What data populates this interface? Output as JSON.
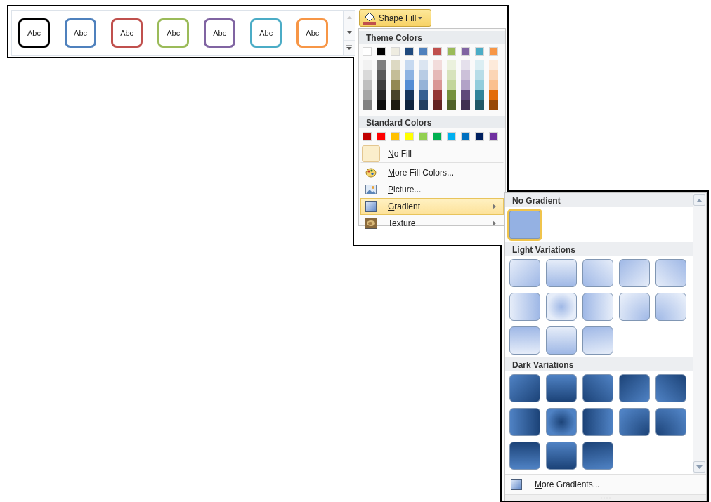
{
  "style_gallery": {
    "styles": [
      {
        "label": "Abc",
        "color": "#000000"
      },
      {
        "label": "Abc",
        "color": "#4f81bd"
      },
      {
        "label": "Abc",
        "color": "#c0504d"
      },
      {
        "label": "Abc",
        "color": "#9bbb59"
      },
      {
        "label": "Abc",
        "color": "#8064a2"
      },
      {
        "label": "Abc",
        "color": "#4bacc6"
      },
      {
        "label": "Abc",
        "color": "#f79646"
      }
    ]
  },
  "shape_fill_button": {
    "label": "Shape Fill"
  },
  "fill_menu": {
    "theme_header": "Theme Colors",
    "theme_colors": [
      {
        "color": "#ffffff",
        "shades": [
          {
            "color": "#f2f2f2"
          },
          {
            "color": "#d9d9d9"
          },
          {
            "color": "#bfbfbf"
          },
          {
            "color": "#a6a6a6"
          },
          {
            "color": "#808080"
          }
        ]
      },
      {
        "color": "#000000",
        "shades": [
          {
            "color": "#7f7f7f"
          },
          {
            "color": "#595959"
          },
          {
            "color": "#3f3f3f"
          },
          {
            "color": "#262626"
          },
          {
            "color": "#0d0d0d"
          }
        ]
      },
      {
        "color": "#eeece1",
        "shades": [
          {
            "color": "#ddd9c3"
          },
          {
            "color": "#c4bd97"
          },
          {
            "color": "#938953"
          },
          {
            "color": "#494429"
          },
          {
            "color": "#1d1b10"
          }
        ]
      },
      {
        "color": "#1f497d",
        "shades": [
          {
            "color": "#c6d9f0"
          },
          {
            "color": "#8db3e2"
          },
          {
            "color": "#548dd4"
          },
          {
            "color": "#17365d"
          },
          {
            "color": "#0f243e"
          }
        ]
      },
      {
        "color": "#4f81bd",
        "shades": [
          {
            "color": "#dbe5f1"
          },
          {
            "color": "#b8cce4"
          },
          {
            "color": "#95b3d7"
          },
          {
            "color": "#366092"
          },
          {
            "color": "#244061"
          }
        ]
      },
      {
        "color": "#c0504d",
        "shades": [
          {
            "color": "#f2dcdb"
          },
          {
            "color": "#e5b9b7"
          },
          {
            "color": "#d99694"
          },
          {
            "color": "#953734"
          },
          {
            "color": "#632423"
          }
        ]
      },
      {
        "color": "#9bbb59",
        "shades": [
          {
            "color": "#ebf1dd"
          },
          {
            "color": "#d7e3bc"
          },
          {
            "color": "#c3d69b"
          },
          {
            "color": "#76923c"
          },
          {
            "color": "#4f6128"
          }
        ]
      },
      {
        "color": "#8064a2",
        "shades": [
          {
            "color": "#e5e0ec"
          },
          {
            "color": "#ccc1d9"
          },
          {
            "color": "#b2a2c7"
          },
          {
            "color": "#5f497a"
          },
          {
            "color": "#3f3151"
          }
        ]
      },
      {
        "color": "#4bacc6",
        "shades": [
          {
            "color": "#dbeef3"
          },
          {
            "color": "#b7dde8"
          },
          {
            "color": "#92cddc"
          },
          {
            "color": "#31859b"
          },
          {
            "color": "#205867"
          }
        ]
      },
      {
        "color": "#f79646",
        "shades": [
          {
            "color": "#fdeada"
          },
          {
            "color": "#fbd5b5"
          },
          {
            "color": "#fac08f"
          },
          {
            "color": "#e36c09"
          },
          {
            "color": "#974806"
          }
        ]
      }
    ],
    "standard_header": "Standard Colors",
    "standard_colors": [
      {
        "color": "#c00000"
      },
      {
        "color": "#ff0000"
      },
      {
        "color": "#ffc000"
      },
      {
        "color": "#ffff00"
      },
      {
        "color": "#92d050"
      },
      {
        "color": "#00b050"
      },
      {
        "color": "#00b0f0"
      },
      {
        "color": "#0070c0"
      },
      {
        "color": "#002060"
      },
      {
        "color": "#7030a0"
      }
    ],
    "items": [
      {
        "kind": "no-fill",
        "label": "No Fill",
        "selected": false,
        "submenu": false
      },
      {
        "kind": "more-colors",
        "label": "More Fill Colors...",
        "selected": false,
        "submenu": false
      },
      {
        "kind": "picture",
        "label": "Picture...",
        "selected": false,
        "submenu": false
      },
      {
        "kind": "gradient",
        "label": "Gradient",
        "selected": true,
        "submenu": true
      },
      {
        "kind": "texture",
        "label": "Texture",
        "selected": false,
        "submenu": true
      }
    ]
  },
  "gradient_menu": {
    "sections": [
      {
        "title": "No Gradient",
        "kind": "flat",
        "tiles": [
          {
            "kind": "none",
            "selected": true
          }
        ]
      },
      {
        "title": "Light Variations",
        "kind": "light",
        "tiles": [
          {
            "kind": "down-right",
            "selected": false
          },
          {
            "kind": "down",
            "selected": false
          },
          {
            "kind": "down-left",
            "selected": false
          },
          {
            "kind": "up-left",
            "selected": false
          },
          {
            "kind": "up-right",
            "selected": false
          },
          {
            "kind": "right",
            "selected": false
          },
          {
            "kind": "center",
            "selected": false
          },
          {
            "kind": "left",
            "selected": false
          },
          {
            "kind": "corner-bottom-right",
            "selected": false
          },
          {
            "kind": "corner-bottom-left",
            "selected": false
          },
          {
            "kind": "up",
            "selected": false
          },
          {
            "kind": "down",
            "selected": false
          },
          {
            "kind": "up-alt",
            "selected": false
          }
        ]
      },
      {
        "title": "Dark Variations",
        "kind": "dark",
        "tiles": [
          {
            "kind": "down-right",
            "selected": false
          },
          {
            "kind": "down",
            "selected": false
          },
          {
            "kind": "down-left",
            "selected": false
          },
          {
            "kind": "up-left",
            "selected": false
          },
          {
            "kind": "up-right",
            "selected": false
          },
          {
            "kind": "right",
            "selected": false
          },
          {
            "kind": "center",
            "selected": false
          },
          {
            "kind": "left",
            "selected": false
          },
          {
            "kind": "corner-bottom-right",
            "selected": false
          },
          {
            "kind": "corner-bottom-left",
            "selected": false
          },
          {
            "kind": "up",
            "selected": false
          },
          {
            "kind": "down",
            "selected": false
          },
          {
            "kind": "up-alt",
            "selected": false
          }
        ]
      }
    ],
    "more": {
      "label": "More Gradients..."
    }
  }
}
